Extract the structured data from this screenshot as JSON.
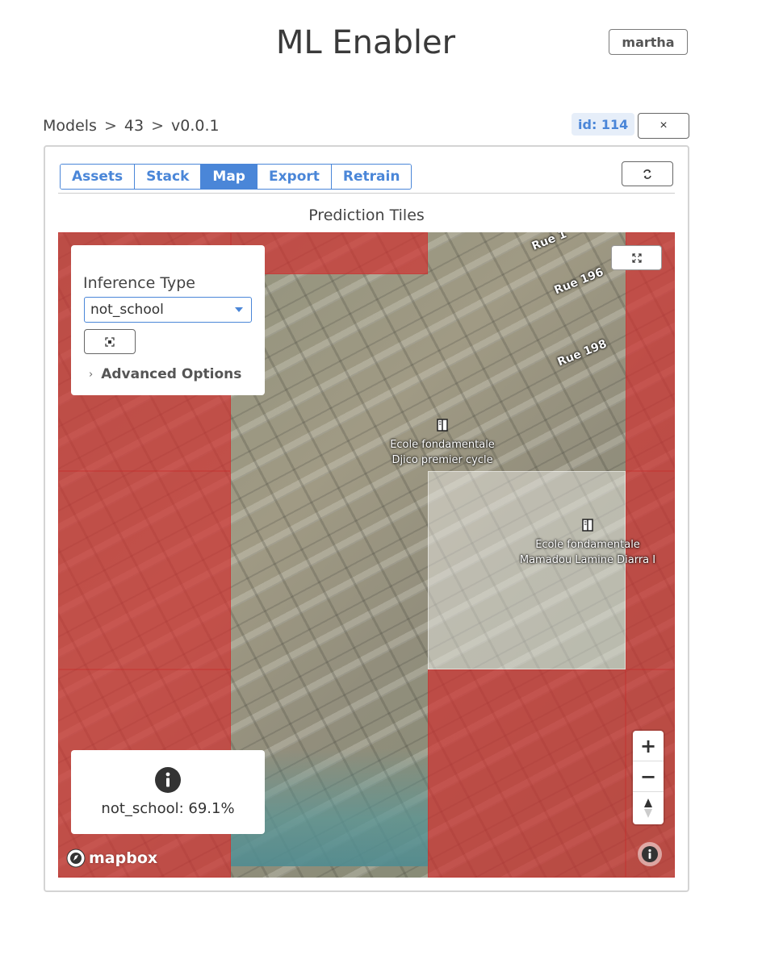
{
  "header": {
    "app_title": "ML Enabler",
    "user_label": "martha"
  },
  "breadcrumb": {
    "items": [
      "Models",
      "43",
      "v0.0.1"
    ],
    "separator": ">"
  },
  "prediction": {
    "id_badge": "id: 114",
    "close_label": "×"
  },
  "tabs": [
    {
      "label": "Assets",
      "active": false
    },
    {
      "label": "Stack",
      "active": false
    },
    {
      "label": "Map",
      "active": true
    },
    {
      "label": "Export",
      "active": false
    },
    {
      "label": "Retrain",
      "active": false
    }
  ],
  "refresh": {
    "icon": "refresh-icon"
  },
  "section": {
    "title": "Prediction Tiles"
  },
  "map": {
    "controls": {
      "inference_label": "Inference Type",
      "inference_value": "not_school",
      "focus_icon": "focus-icon",
      "advanced_label": "Advanced Options"
    },
    "road_labels": [
      "Rue 1",
      "Rue 196",
      "Rue 198"
    ],
    "pois": [
      {
        "line1": "Ecole fondamentale",
        "line2": "Djico premier cycle"
      },
      {
        "line1": "Ecole fondamentale",
        "line2": "Mamadou Lamine Diarra I"
      }
    ],
    "info": {
      "text": "not_school: 69.1%"
    },
    "zoom": {
      "in": "+",
      "out": "−"
    },
    "logo": "mapbox",
    "colors": {
      "tile_red": "#d32e2e",
      "accent": "#4a86d8"
    }
  }
}
